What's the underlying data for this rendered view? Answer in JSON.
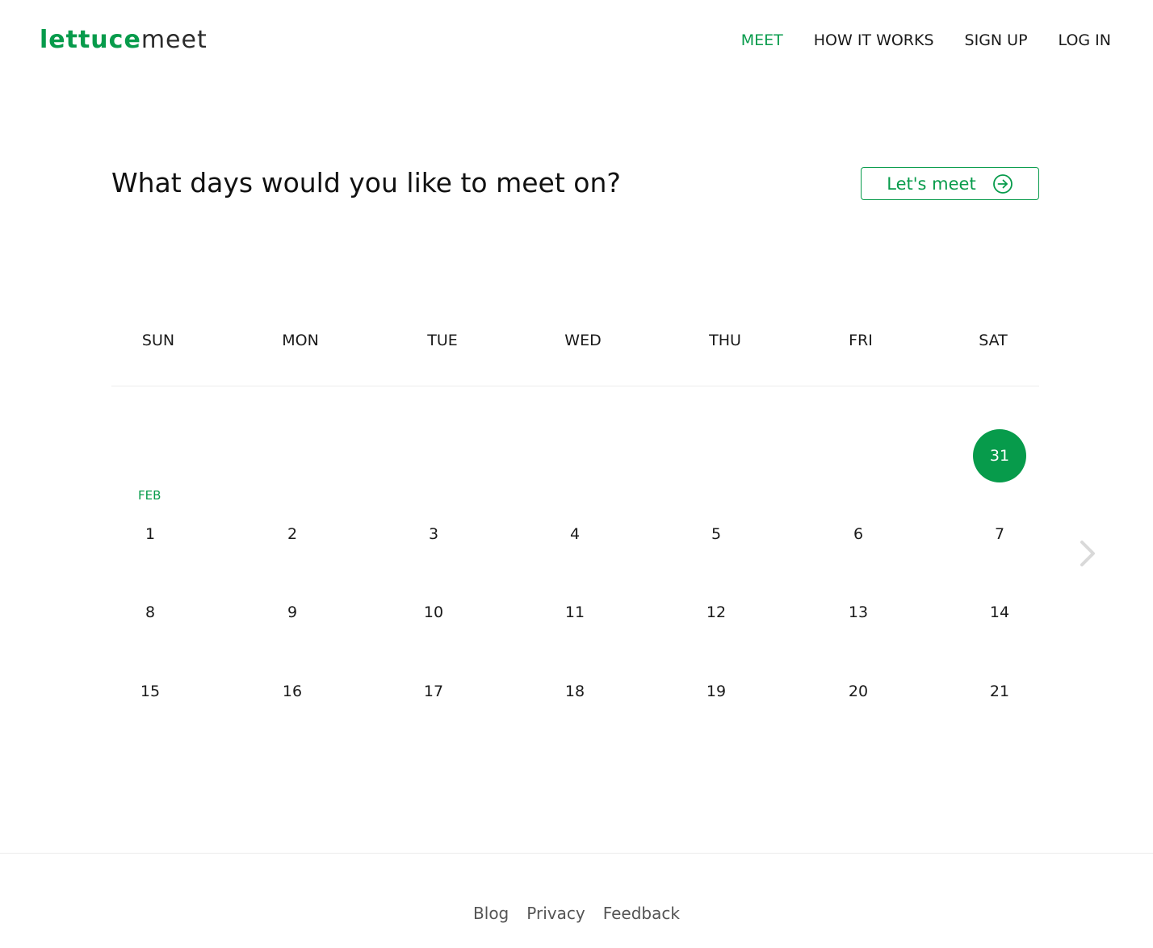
{
  "brand": {
    "logo_part1": "lettuce",
    "logo_part2": "meet",
    "accent_color": "#079b4b"
  },
  "nav": {
    "items": [
      {
        "label": "MEET",
        "active": true
      },
      {
        "label": "HOW IT WORKS",
        "active": false
      },
      {
        "label": "SIGN UP",
        "active": false
      },
      {
        "label": "LOG IN",
        "active": false
      }
    ]
  },
  "main": {
    "title": "What days would you like to meet on?",
    "cta_label": "Let's meet",
    "cta_icon": "arrow-circle-right-icon"
  },
  "calendar": {
    "weekdays": [
      "SUN",
      "MON",
      "TUE",
      "WED",
      "THU",
      "FRI",
      "SAT"
    ],
    "month_label": "FEB",
    "rows": [
      [
        "",
        "",
        "",
        "",
        "",
        "",
        "31"
      ],
      [
        "1",
        "2",
        "3",
        "4",
        "5",
        "6",
        "7"
      ],
      [
        "8",
        "9",
        "10",
        "11",
        "12",
        "13",
        "14"
      ],
      [
        "15",
        "16",
        "17",
        "18",
        "19",
        "20",
        "21"
      ]
    ],
    "selected": [
      "31"
    ],
    "next_icon": "chevron-right-icon"
  },
  "footer": {
    "links": [
      "Blog",
      "Privacy",
      "Feedback"
    ]
  }
}
